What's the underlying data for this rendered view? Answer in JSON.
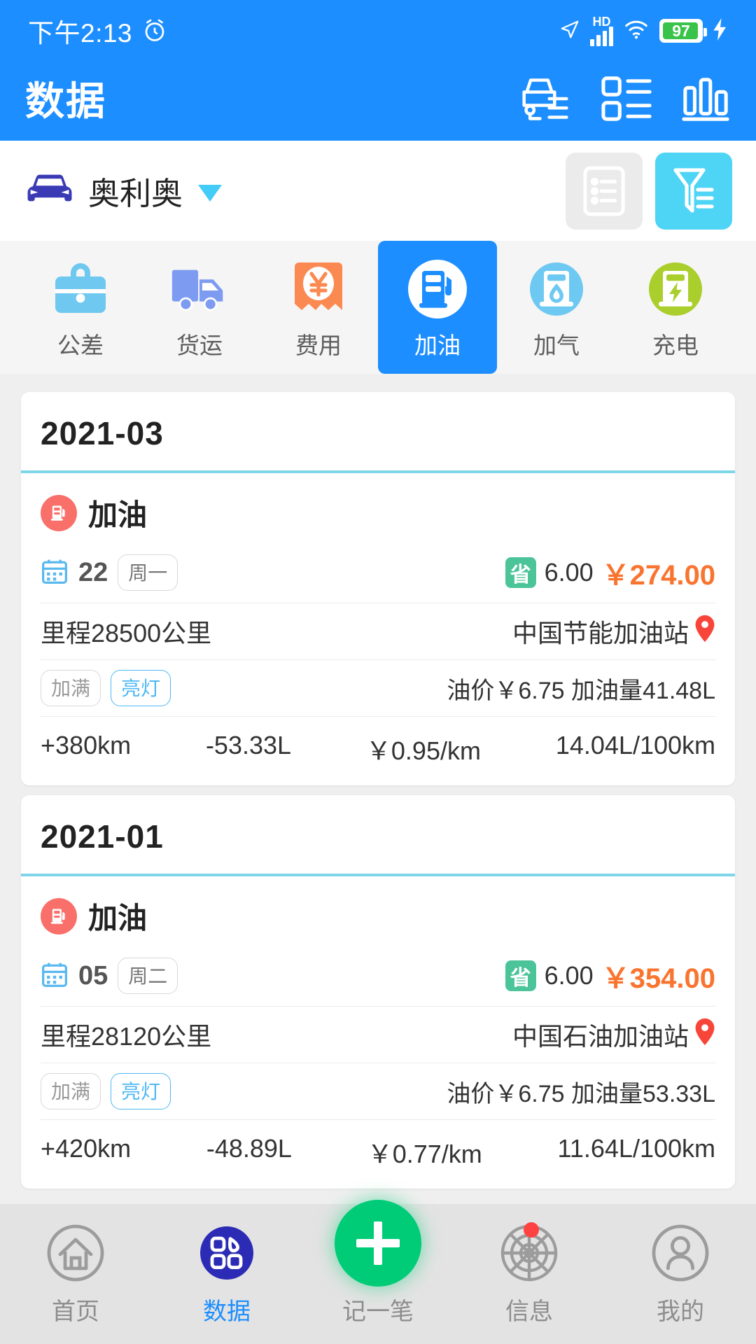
{
  "status_bar": {
    "time": "下午2:13",
    "alarm_icon": "alarm-clock-icon",
    "location_icon": "location-arrow-icon",
    "hd_label": "HD",
    "signal_icon": "cellular-signal-icon",
    "wifi_icon": "wifi-icon",
    "battery_percent": "97",
    "charging_icon": "charging-bolt-icon"
  },
  "app_bar": {
    "title": "数据",
    "actions": [
      {
        "name": "vehicle-record-icon",
        "label": "车辆记录"
      },
      {
        "name": "list-view-icon",
        "label": "列表"
      },
      {
        "name": "bar-chart-icon",
        "label": "统计图表"
      }
    ]
  },
  "vehicle_selector": {
    "icon": "car-icon",
    "name": "奥利奥",
    "caret": "chevron-down-icon",
    "list_button": "list-toggle-icon",
    "filter_button": "filter-icon"
  },
  "categories": [
    {
      "label": "公差",
      "icon": "briefcase-icon",
      "color": "#6fc8ef",
      "selected": false
    },
    {
      "label": "货运",
      "icon": "truck-icon",
      "color": "#7d9bf0",
      "selected": false
    },
    {
      "label": "费用",
      "icon": "receipt-yuan-icon",
      "color": "#fb8a52",
      "selected": false
    },
    {
      "label": "加油",
      "icon": "fuel-pump-icon",
      "color": "#1d8eff",
      "selected": true
    },
    {
      "label": "加气",
      "icon": "gas-pump-icon",
      "color": "#6ec9f2",
      "selected": false
    },
    {
      "label": "充电",
      "icon": "charging-station-icon",
      "color": "#aace2c",
      "selected": false
    }
  ],
  "groups": [
    {
      "month": "2021-03",
      "records": [
        {
          "type_label": "加油",
          "type_icon": "fuel-pump-icon",
          "day": "22",
          "weekday": "周一",
          "save_badge": "省",
          "save_amount": "6.00",
          "price": "￥274.00",
          "mileage": "里程28500公里",
          "station": "中国节能加油站",
          "location_icon": "map-pin-icon",
          "tags": [
            {
              "text": "加满",
              "style": "gray"
            },
            {
              "text": "亮灯",
              "style": "blue"
            }
          ],
          "fuel_info": "油价￥6.75  加油量41.48L",
          "stats": [
            "+380km",
            "-53.33L",
            "￥0.95/km",
            "14.04L/100km"
          ]
        }
      ]
    },
    {
      "month": "2021-01",
      "records": [
        {
          "type_label": "加油",
          "type_icon": "fuel-pump-icon",
          "day": "05",
          "weekday": "周二",
          "save_badge": "省",
          "save_amount": "6.00",
          "price": "￥354.00",
          "mileage": "里程28120公里",
          "station": "中国石油加油站",
          "location_icon": "map-pin-icon",
          "tags": [
            {
              "text": "加满",
              "style": "gray"
            },
            {
              "text": "亮灯",
              "style": "blue"
            }
          ],
          "fuel_info": "油价￥6.75  加油量53.33L",
          "stats": [
            "+420km",
            "-48.89L",
            "￥0.77/km",
            "11.64L/100km"
          ]
        }
      ]
    }
  ],
  "tab_bar": [
    {
      "label": "首页",
      "icon": "home-icon",
      "active": false,
      "badge": false
    },
    {
      "label": "数据",
      "icon": "dashboard-grid-icon",
      "active": true,
      "badge": false
    },
    {
      "label": "记一笔",
      "icon": "plus-icon",
      "active": false,
      "badge": false,
      "fab": true
    },
    {
      "label": "信息",
      "icon": "radar-icon",
      "active": false,
      "badge": true
    },
    {
      "label": "我的",
      "icon": "user-icon",
      "active": false,
      "badge": false
    }
  ],
  "colors": {
    "primary": "#1d8eff",
    "accent_cyan": "#4ed4f5",
    "price_orange": "#f9742f",
    "save_green": "#4cc49a",
    "fab_green": "#00cc77",
    "tag_blue": "#4fb8f5"
  }
}
